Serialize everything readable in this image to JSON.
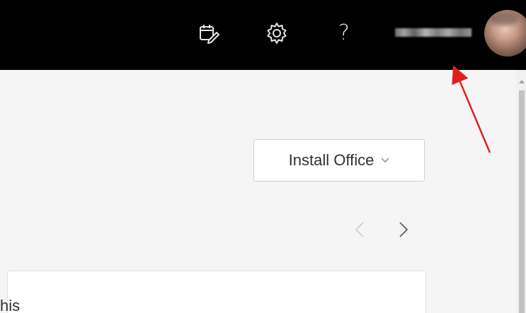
{
  "topbar": {
    "icons": {
      "calendar_edit": "calendar-edit-icon",
      "settings": "gear-icon",
      "help": "help-icon"
    },
    "help_glyph": "?",
    "colors": {
      "background": "#000000",
      "icon": "#e6e6e6"
    }
  },
  "main": {
    "install_button": {
      "label": "Install Office",
      "icon": "chevron-down-icon"
    },
    "pager": {
      "prev_icon": "chevron-left-icon",
      "next_icon": "chevron-right-icon"
    },
    "card": {
      "text": "his"
    }
  },
  "annotation": {
    "arrow_color": "#e02020"
  }
}
